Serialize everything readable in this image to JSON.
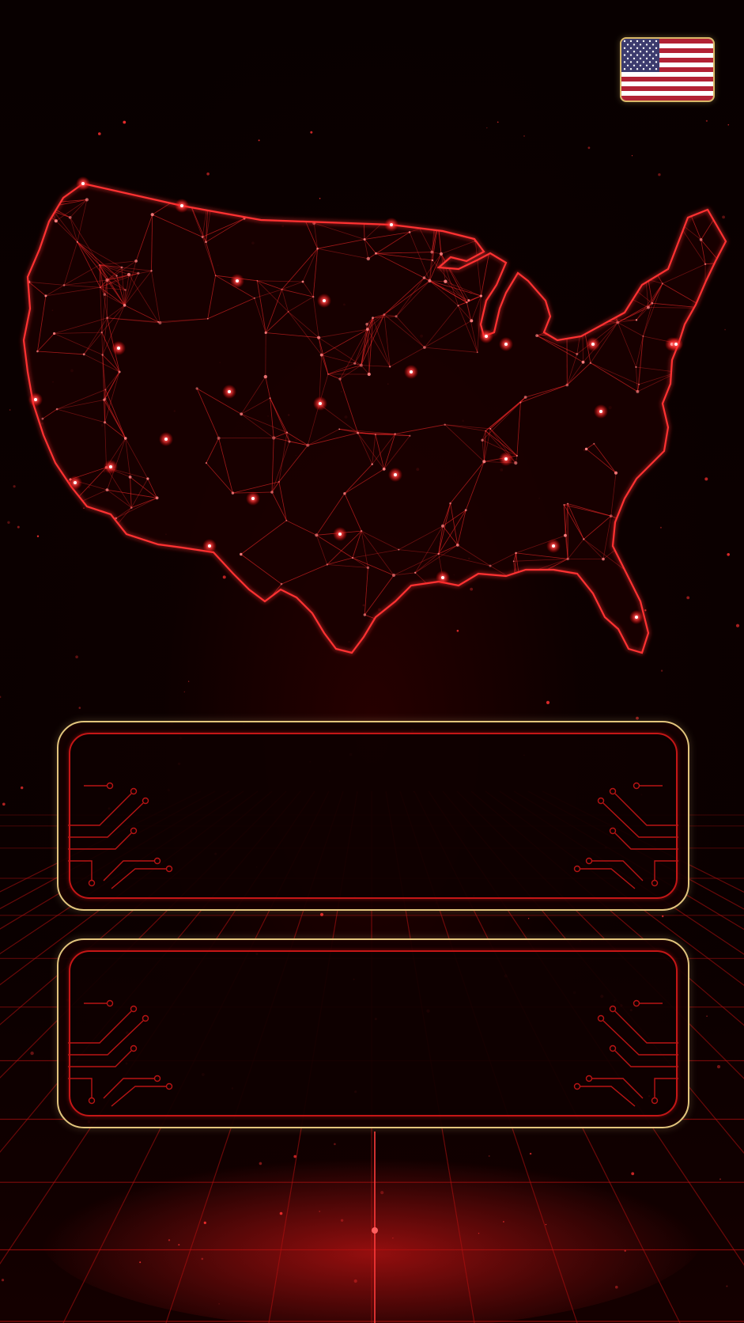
{
  "screen": {
    "name": "us-network-map-background",
    "flag": {
      "icon": "us-flag-icon",
      "stripe_red": "#b22234",
      "canton_blue": "#3c3b6e"
    },
    "map": {
      "icon": "us-map-network-icon",
      "glow_color": "#ff2a2a"
    },
    "panels": [
      {
        "text": ""
      },
      {
        "text": ""
      }
    ],
    "colors": {
      "background": "#050000",
      "accent_red": "#c41616",
      "frame_gold": "#e2c57d"
    }
  }
}
